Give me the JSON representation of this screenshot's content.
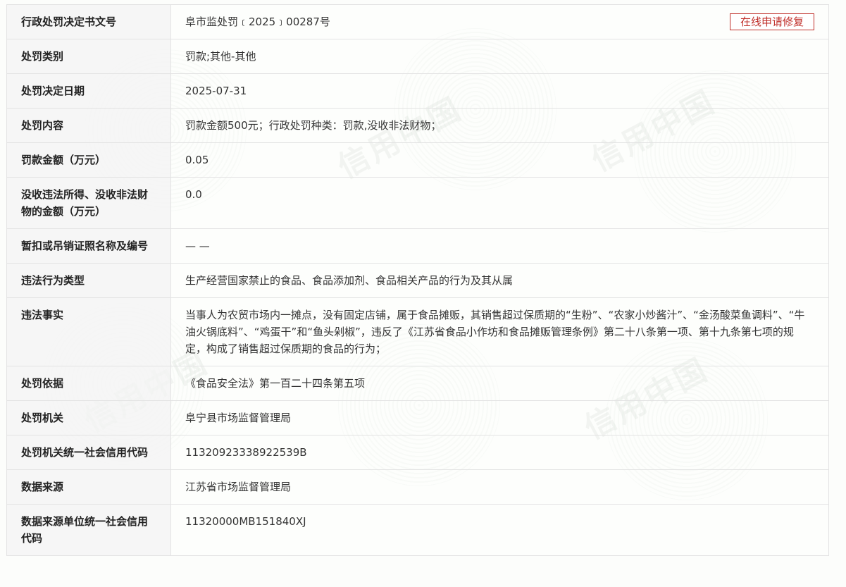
{
  "repair_button_label": "在线申请修复",
  "watermark": "信用中国",
  "rows": [
    {
      "label": "行政处罚决定书文号",
      "value": "阜市监处罚﹝2025﹞00287号"
    },
    {
      "label": "处罚类别",
      "value": "罚款;其他-其他"
    },
    {
      "label": "处罚决定日期",
      "value": "2025-07-31"
    },
    {
      "label": "处罚内容",
      "value": "罚款金额500元；行政处罚种类：罚款,没收非法财物；"
    },
    {
      "label": "罚款金额（万元）",
      "value": "0.05"
    },
    {
      "label": "没收违法所得、没收非法财物的金额（万元）",
      "value": "0.0"
    },
    {
      "label": "暂扣或吊销证照名称及编号",
      "value": "— —"
    },
    {
      "label": "违法行为类型",
      "value": "生产经营国家禁止的食品、食品添加剂、食品相关产品的行为及其从属"
    },
    {
      "label": "违法事实",
      "value": "当事人为农贸市场内一摊点，没有固定店铺，属于食品摊贩，其销售超过保质期的“生粉”、“农家小炒酱汁”、“金汤酸菜鱼调料”、“牛油火锅底料”、“鸡蛋干”和“鱼头剁椒”，违反了《江苏省食品小作坊和食品摊贩管理条例》第二十八条第一项、第十九条第七项的规定，构成了销售超过保质期的食品的行为；"
    },
    {
      "label": "处罚依据",
      "value": "《食品安全法》第一百二十四条第五项"
    },
    {
      "label": "处罚机关",
      "value": "阜宁县市场监督管理局"
    },
    {
      "label": "处罚机关统一社会信用代码",
      "value": "11320923338922539B"
    },
    {
      "label": "数据来源",
      "value": "江苏省市场监督管理局"
    },
    {
      "label": "数据来源单位统一社会信用代码",
      "value": "11320000MB151840XJ"
    }
  ]
}
